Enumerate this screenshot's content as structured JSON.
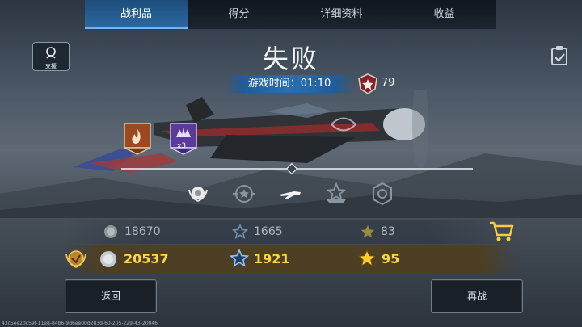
{
  "tabs": [
    {
      "label": "战利品"
    },
    {
      "label": "得分"
    },
    {
      "label": "详细资料"
    },
    {
      "label": "收益"
    }
  ],
  "support": {
    "label": "支援"
  },
  "result": {
    "title": "失败"
  },
  "time": {
    "label": "游戏时间：01:10"
  },
  "rank": {
    "value": "79"
  },
  "badges": [
    {
      "name": "fire-badge",
      "label": ""
    },
    {
      "name": "purple-badge",
      "label": "x3"
    }
  ],
  "resources": {
    "base": {
      "silver": "18670",
      "xp": "1665",
      "stars": "83"
    },
    "boosted": {
      "silver": "20537",
      "xp": "1921",
      "stars": "95"
    }
  },
  "buttons": {
    "back": "返回",
    "retry": "再战"
  },
  "footer": {
    "code": "43c5ee20c59f-11e8-84b6-9d6ee00d283d-60-205-229-43-20046"
  },
  "colors": {
    "accent": "#2b6aa4",
    "gold": "#ffd24a"
  }
}
